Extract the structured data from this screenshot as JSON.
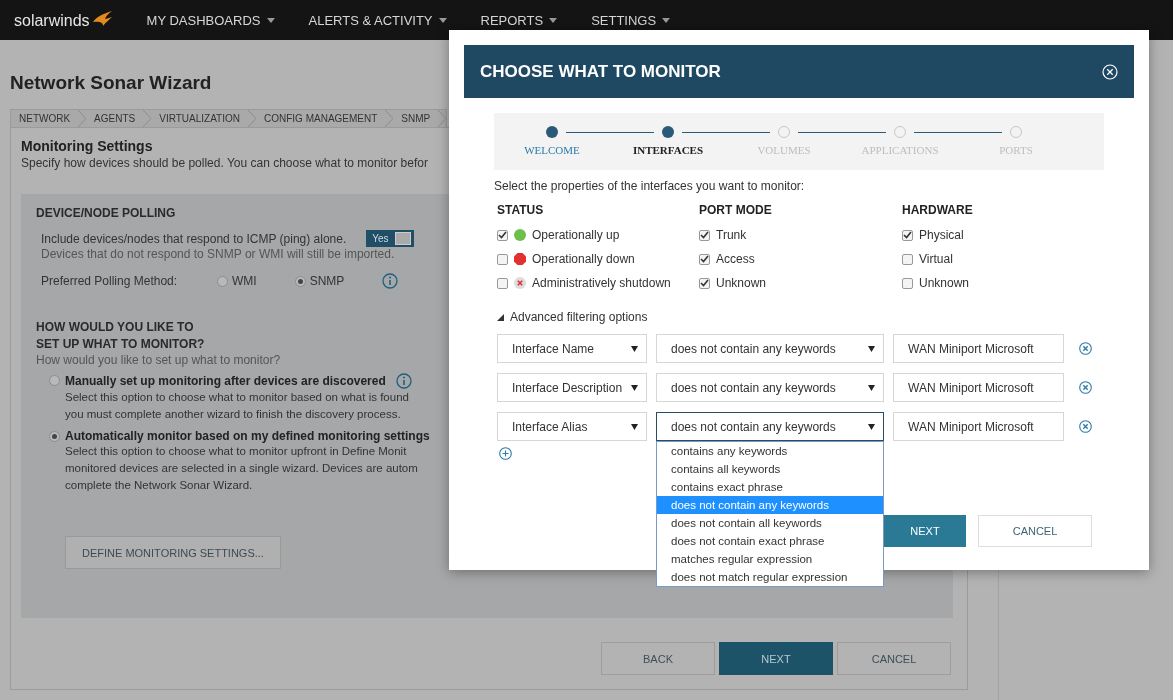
{
  "nav": {
    "logo": "solarwinds",
    "menus": [
      "MY DASHBOARDS",
      "ALERTS & ACTIVITY",
      "REPORTS",
      "SETTINGS"
    ]
  },
  "page_title": "Network Sonar Wizard",
  "wizard_tabs": [
    "NETWORK",
    "AGENTS",
    "VIRTUALIZATION",
    "CONFIG MANAGEMENT",
    "SNMP"
  ],
  "section": {
    "title": "Monitoring Settings",
    "description": "Specify how devices should be polled. You can choose what to monitor befor"
  },
  "polling": {
    "heading": "DEVICE/NODE POLLING",
    "icmp_label": "Include devices/nodes that respond to ICMP (ping) alone.",
    "icmp_toggle": {
      "label": "Yes",
      "on": true
    },
    "icmp_note": "Devices that do not respond to SNMP or WMI will still be imported.",
    "method_label": "Preferred Polling Method:",
    "methods": [
      {
        "label": "WMI",
        "selected": false
      },
      {
        "label": "SNMP",
        "selected": true
      }
    ]
  },
  "monitor_setup": {
    "heading_lines": [
      "HOW WOULD YOU LIKE TO",
      "SET UP WHAT TO MONITOR?"
    ],
    "question": "How would you like to set up what to monitor?",
    "options": [
      {
        "title": "Manually set up monitoring after devices are discovered",
        "selected": false,
        "info": true,
        "description": [
          "Select this option to choose what to monitor based on what is found",
          "you must complete another wizard to finish the discovery process."
        ]
      },
      {
        "title": "Automatically monitor based on my defined monitoring settings",
        "selected": true,
        "info": false,
        "description": [
          "Select this option to choose what to monitor upfront in Define Monit",
          "monitored devices are selected in a single wizard. Devices are autom",
          "complete the Network Sonar Wizard."
        ]
      }
    ],
    "define_button": "DEFINE MONITORING SETTINGS..."
  },
  "footer_buttons": {
    "back": "BACK",
    "next": "NEXT",
    "cancel": "CANCEL"
  },
  "modal": {
    "title": "CHOOSE WHAT TO MONITOR",
    "steps": [
      {
        "label": "WELCOME",
        "completed": true,
        "selected": false
      },
      {
        "label": "INTERFACES",
        "completed": false,
        "selected": true
      },
      {
        "label": "VOLUMES",
        "completed": false,
        "selected": false
      },
      {
        "label": "APPLICATIONS",
        "completed": false,
        "selected": false
      },
      {
        "label": "PORTS",
        "completed": false,
        "selected": false
      }
    ],
    "intro": "Select the properties of the interfaces you want to monitor:",
    "columns": [
      {
        "heading": "STATUS",
        "items": [
          {
            "label": "Operationally up",
            "checked": true,
            "kind": "up"
          },
          {
            "label": "Operationally down",
            "checked": false,
            "kind": "down"
          },
          {
            "label": "Administratively shutdown",
            "checked": false,
            "kind": "shutdown"
          }
        ]
      },
      {
        "heading": "PORT MODE",
        "items": [
          {
            "label": "Trunk",
            "checked": true
          },
          {
            "label": "Access",
            "checked": true
          },
          {
            "label": "Unknown",
            "checked": true
          }
        ]
      },
      {
        "heading": "HARDWARE",
        "items": [
          {
            "label": "Physical",
            "checked": true
          },
          {
            "label": "Virtual",
            "checked": false
          },
          {
            "label": "Unknown",
            "checked": false
          }
        ]
      }
    ],
    "advanced": {
      "label": "Advanced filtering options",
      "expanded": true
    },
    "filters": [
      {
        "field": "Interface Name",
        "operator": "does not contain any keywords",
        "value": "WAN Miniport Microsoft",
        "open": false
      },
      {
        "field": "Interface Description",
        "operator": "does not contain any keywords",
        "value": "WAN Miniport Microsoft",
        "open": false
      },
      {
        "field": "Interface Alias",
        "operator": "does not contain any keywords",
        "value": "WAN Miniport Microsoft",
        "open": true
      }
    ],
    "operator_options": [
      {
        "label": "contains any keywords",
        "selected": false
      },
      {
        "label": "contains all keywords",
        "selected": false
      },
      {
        "label": "contains exact phrase",
        "selected": false
      },
      {
        "label": "does not contain any keywords",
        "selected": true
      },
      {
        "label": "does not contain all keywords",
        "selected": false
      },
      {
        "label": "does not contain exact phrase",
        "selected": false
      },
      {
        "label": "matches regular expression",
        "selected": false
      },
      {
        "label": "does not match regular expression",
        "selected": false
      }
    ],
    "next": "NEXT",
    "cancel": "CANCEL"
  }
}
